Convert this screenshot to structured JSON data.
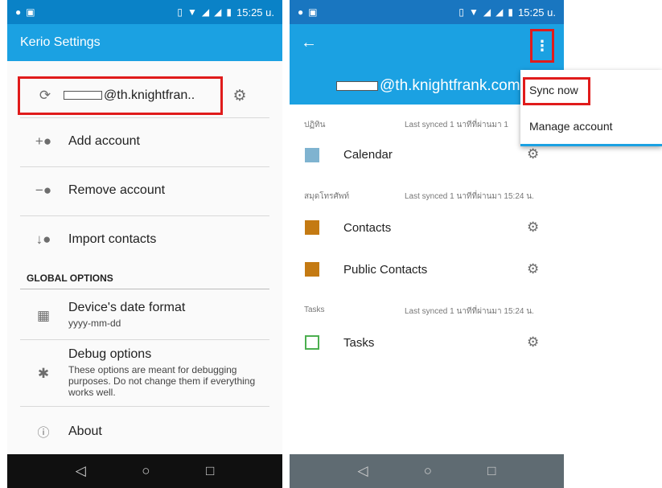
{
  "left_screen": {
    "status": {
      "time": "15:25 u."
    },
    "app_title": "Kerio Settings",
    "account": {
      "email": "@th.knightfran..",
      "masked_prefix": ""
    },
    "menu_items": [
      {
        "label": "Add account",
        "icon": "add-person-icon"
      },
      {
        "label": "Remove account",
        "icon": "remove-person-icon"
      },
      {
        "label": "Import contacts",
        "icon": "import-person-icon"
      }
    ],
    "section_title": "GLOBAL OPTIONS",
    "options": [
      {
        "title": "Device's date format",
        "subtitle": "yyyy-mm-dd",
        "icon": "calendar-icon"
      },
      {
        "title": "Debug options",
        "subtitle": "These options are meant for debugging purposes. Do not change them if everything works well.",
        "icon": "bug-icon"
      },
      {
        "title": "About",
        "subtitle": "",
        "icon": "info-icon"
      }
    ]
  },
  "right_screen": {
    "status": {
      "time": "15:25 u."
    },
    "account_email": "@th.knightfrank.com",
    "sections": [
      {
        "header": "ปฏิทิน",
        "last_synced": "Last synced 1 นาทีที่ผ่านมา 1"
      },
      {
        "header": "สมุดโทรศัพท์",
        "last_synced": "Last synced 1 นาทีที่ผ่านมา 15:24 น."
      },
      {
        "header": "Tasks",
        "last_synced": "Last synced 1 นาทีที่ผ่านมา 15:24 น."
      }
    ],
    "items": [
      {
        "label": "Calendar",
        "color": "#7fb3d0"
      },
      {
        "label": "Contacts",
        "color": "#c47a13"
      },
      {
        "label": "Public Contacts",
        "color": "#c47a13"
      },
      {
        "label": "Tasks",
        "color": "#4caf50"
      }
    ],
    "popup_menu": {
      "items": [
        "Sync now",
        "Manage account"
      ]
    }
  },
  "colors": {
    "accent": "#1ba1e2",
    "highlight": "#e01b1b"
  }
}
